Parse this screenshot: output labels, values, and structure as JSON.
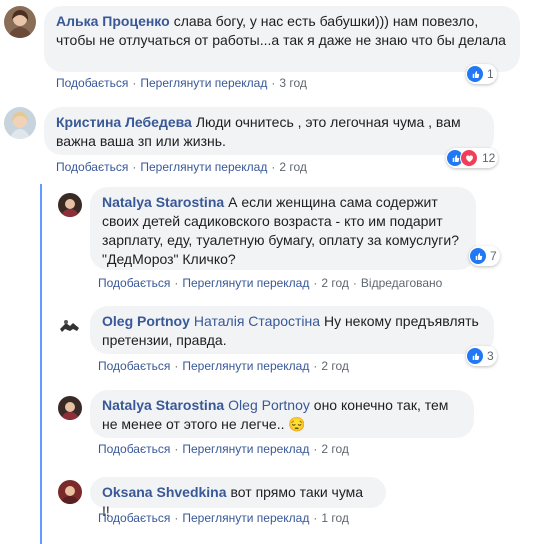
{
  "comments": [
    {
      "author": "Алька Проценко",
      "mention": "",
      "text": "слава богу, у нас есть бабушки))) нам повезло, чтобы не отлучаться от работы...а так я даже не знаю что бы делала",
      "actions": [
        "Подобається",
        "Переглянути переклад",
        "3 год"
      ],
      "reactions": {
        "count": "1",
        "icons": [
          "like-icon"
        ]
      }
    },
    {
      "author": "Кристина Лебедева",
      "mention": "",
      "text": "Люди очнитесь , это легочная чума , вам важна ваша зп или жизнь.",
      "actions": [
        "Подобається",
        "Переглянути переклад",
        "2 год"
      ],
      "reactions": {
        "count": "12",
        "icons": [
          "like-icon",
          "love-icon"
        ]
      }
    },
    {
      "author": "Natalya Starostina",
      "mention": "",
      "text": "А если женщина сама содержит своих детей садиковского возраста - кто им подарит зарплату, еду, туалетную бумагу, оплату за комуслуги? \"ДедМороз\" Кличко?",
      "actions": [
        "Подобається",
        "Переглянути переклад",
        "2 год",
        "Відредаговано"
      ],
      "reactions": {
        "count": "7",
        "icons": [
          "like-icon"
        ]
      }
    },
    {
      "author": "Oleg Portnoy",
      "mention": "Наталія Старостіна",
      "text": "Ну некому предъявлять претензии, правда.",
      "actions": [
        "Подобається",
        "Переглянути переклад",
        "2 год"
      ],
      "reactions": {
        "count": "3",
        "icons": [
          "like-icon"
        ]
      }
    },
    {
      "author": "Natalya Starostina",
      "mention": "Oleg Portnoy",
      "text": "оно конечно так, тем не менее от этого не легче..",
      "emoji": "😔",
      "actions": [
        "Подобається",
        "Переглянути переклад",
        "2 год"
      ]
    },
    {
      "author": "Oksana Shvedkina",
      "mention": "",
      "text": "вот прямо таки чума !!",
      "actions": [
        "Подобається",
        "Переглянути переклад",
        "1 год"
      ]
    }
  ],
  "colors": {
    "author": "#385898",
    "bubble": "#f2f3f5",
    "like": "#2078f4",
    "love": "#f33e58",
    "thread_line": "#4080ff"
  }
}
